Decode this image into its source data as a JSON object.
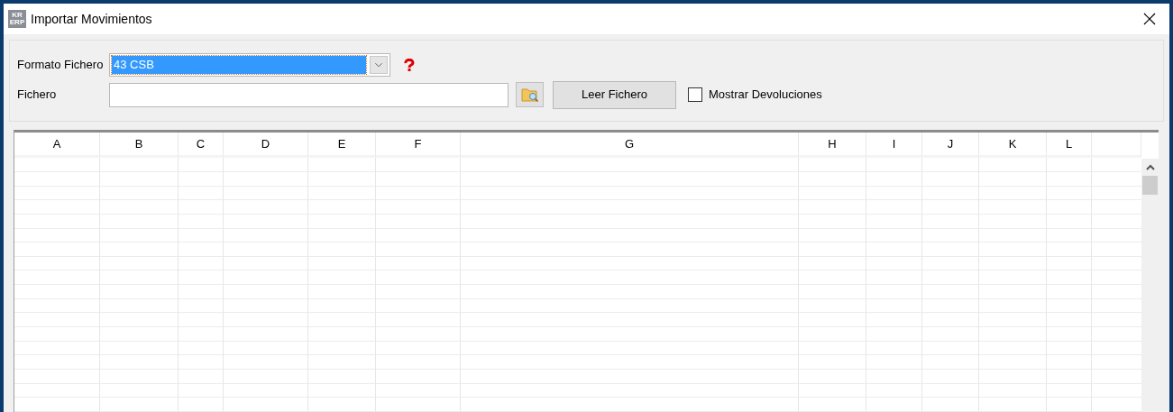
{
  "window": {
    "title": "Importar Movimientos",
    "app_icon": {
      "top": "KR",
      "bottom": "ERP"
    }
  },
  "form": {
    "format_label": "Formato Fichero",
    "format_value": "43 CSB",
    "file_label": "Fichero",
    "read_button": "Leer Fichero",
    "show_returns": {
      "label": "Mostrar Devoluciones",
      "checked": false
    }
  },
  "table": {
    "columns": [
      "A",
      "B",
      "C",
      "D",
      "E",
      "F",
      "G",
      "H",
      "I",
      "J",
      "K",
      "L"
    ]
  }
}
